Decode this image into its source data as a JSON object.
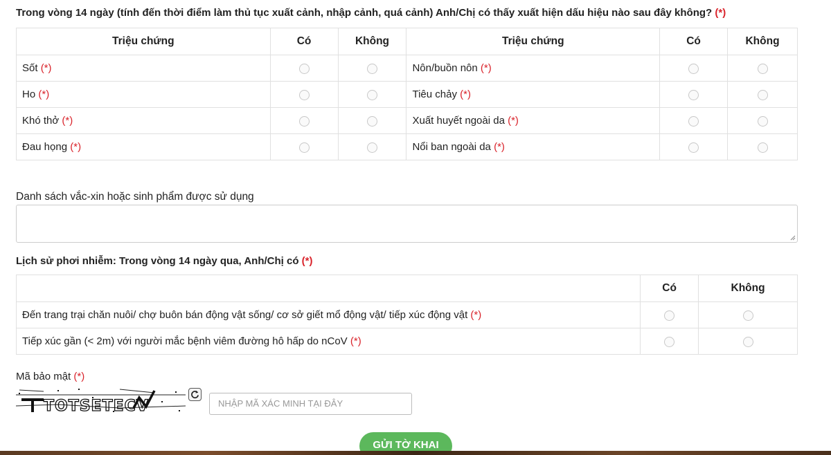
{
  "symptoms_section": {
    "question": "Trong vòng 14 ngày (tính đến thời điểm làm thủ tục xuất cảnh, nhập cảnh, quá cảnh) Anh/Chị có thấy xuất hiện dấu hiệu nào sau đây không?",
    "required_mark": "(*)",
    "headers": {
      "symptom": "Triệu chứng",
      "yes": "Có",
      "no": "Không"
    },
    "left": [
      "Sốt",
      "Ho",
      "Khó thở",
      "Đau họng"
    ],
    "right": [
      "Nôn/buồn nôn",
      "Tiêu chảy",
      "Xuất huyết ngoài da",
      "Nổi ban ngoài da"
    ]
  },
  "vaccine": {
    "label": "Danh sách vắc-xin hoặc sinh phẩm được sử dụng",
    "value": ""
  },
  "exposure": {
    "title": "Lịch sử phơi nhiễm: Trong vòng 14 ngày qua, Anh/Chị có",
    "headers": {
      "yes": "Có",
      "no": "Không"
    },
    "rows": [
      "Đến trang trại chăn nuôi/ chợ buôn bán động vật sống/ cơ sở giết mổ động vật/ tiếp xúc động vật",
      "Tiếp xúc gần (< 2m) với người mắc bệnh viêm đường hô hấp do nCoV"
    ]
  },
  "captcha": {
    "label": "Mã bảo mật",
    "image_text": "TOTSETECV",
    "placeholder": "NHẬP MÃ XÁC MINH TẠI ĐÂY"
  },
  "submit_label": "GỬI TỜ KHAI",
  "required_mark": "(*)"
}
